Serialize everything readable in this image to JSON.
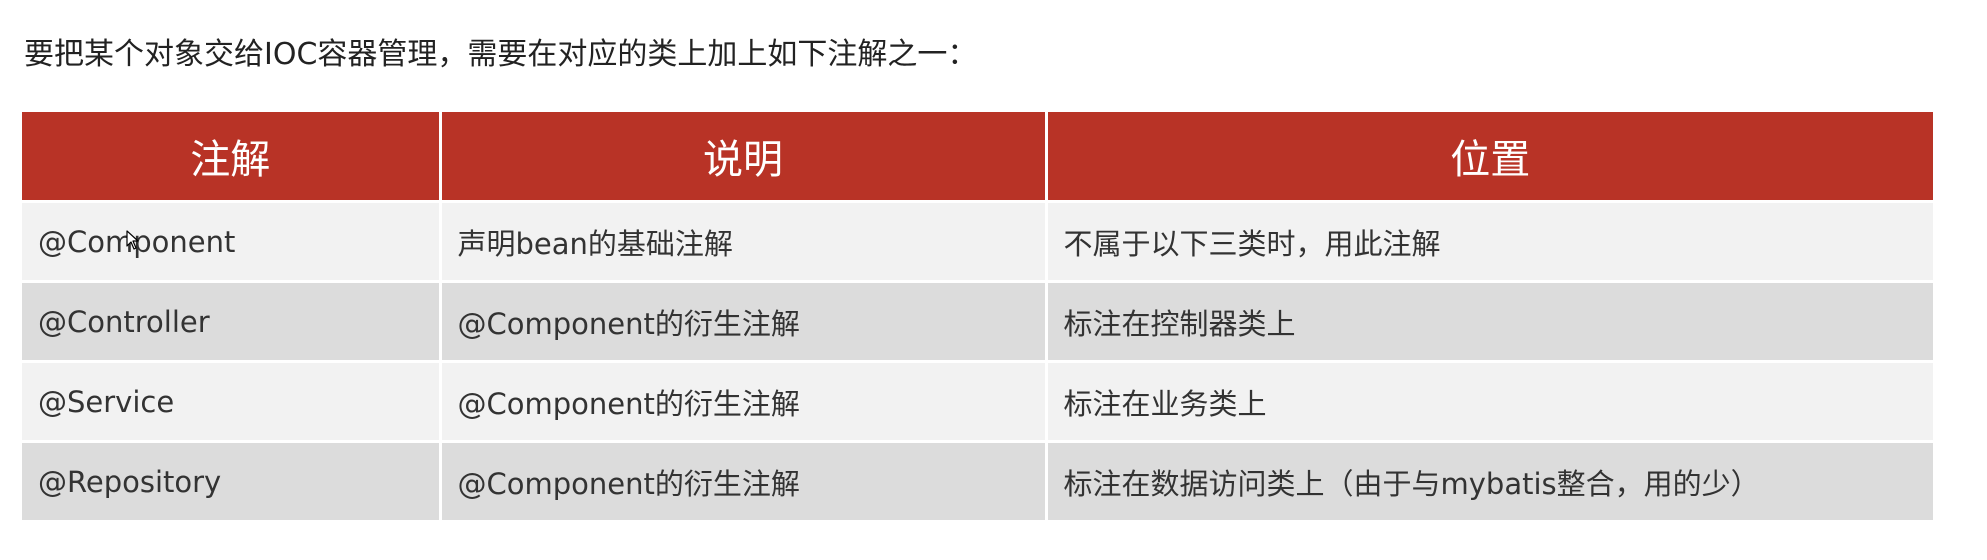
{
  "intro_text": "要把某个对象交给IOC容器管理，需要在对应的类上加上如下注解之一：",
  "colors": {
    "header_bg": "#b83326",
    "header_text": "#ffffff",
    "row_light": "#f2f2f2",
    "row_dark": "#dcdcdc",
    "body_text": "#333333"
  },
  "table": {
    "headers": [
      "注解",
      "说明",
      "位置"
    ],
    "rows": [
      {
        "annotation": "@Component",
        "description": "声明bean的基础注解",
        "location": "不属于以下三类时，用此注解"
      },
      {
        "annotation": "@Controller",
        "description": "@Component的衍生注解",
        "location": "标注在控制器类上"
      },
      {
        "annotation": "@Service",
        "description": "@Component的衍生注解",
        "location": "标注在业务类上"
      },
      {
        "annotation": "@Repository",
        "description": "@Component的衍生注解",
        "location": "标注在数据访问类上（由于与mybatis整合，用的少）"
      }
    ]
  },
  "cursor_icon": "mouse-pointer-icon"
}
